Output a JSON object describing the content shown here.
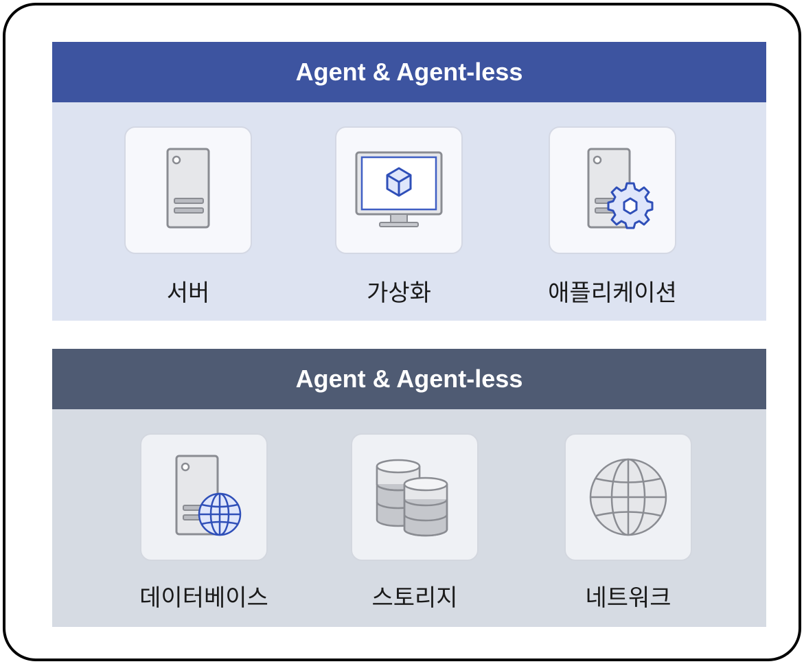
{
  "sections": [
    {
      "title": "Agent & Agent-less",
      "color": "#3d54a0",
      "items": [
        {
          "label": "서버",
          "icon": "server-icon"
        },
        {
          "label": "가상화",
          "icon": "virtual-monitor-icon"
        },
        {
          "label": "애플리케이션",
          "icon": "server-gear-icon"
        }
      ]
    },
    {
      "title": "Agent & Agent-less",
      "color": "#4f5b73",
      "items": [
        {
          "label": "데이터베이스",
          "icon": "server-globe-icon"
        },
        {
          "label": "스토리지",
          "icon": "storage-icon"
        },
        {
          "label": "네트워크",
          "icon": "globe-icon"
        }
      ]
    }
  ]
}
